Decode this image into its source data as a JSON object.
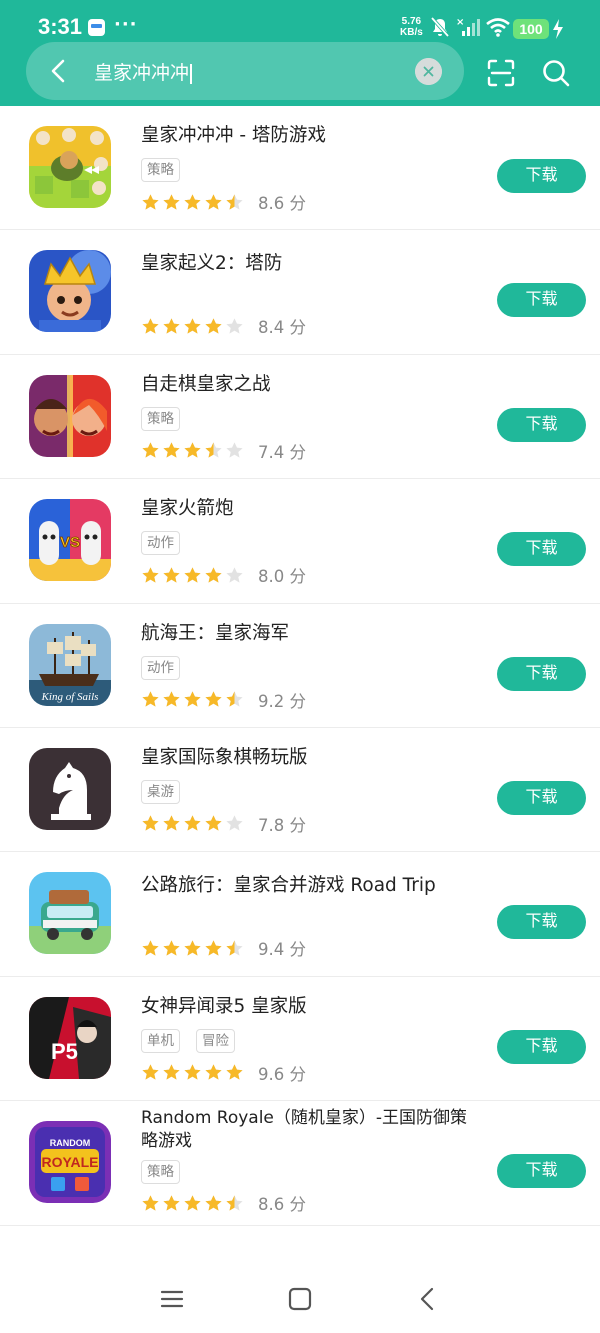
{
  "status_bar": {
    "time": "3:31",
    "net_speed_value": "5.76",
    "net_speed_unit": "KB/s",
    "battery": "100",
    "dots": "···"
  },
  "search": {
    "query": "皇家冲冲冲"
  },
  "apps": [
    {
      "name": "皇家冲冲冲 - 塔防游戏",
      "tags": [
        "策略"
      ],
      "rating": 4.5,
      "score": "8.6 分",
      "button": "下载",
      "icon": "tower-defense-icon"
    },
    {
      "name": "皇家起义2：塔防",
      "tags": [],
      "rating": 4,
      "score": "8.4 分",
      "button": "下载",
      "icon": "king-character-icon"
    },
    {
      "name": "自走棋皇家之战",
      "tags": [
        "策略"
      ],
      "rating": 3.5,
      "score": "7.4 分",
      "button": "下载",
      "icon": "two-heroes-icon"
    },
    {
      "name": "皇家火箭炮",
      "tags": [
        "动作"
      ],
      "rating": 4,
      "score": "8.0 分",
      "button": "下载",
      "icon": "vs-battle-icon"
    },
    {
      "name": "航海王：皇家海军",
      "tags": [
        "动作"
      ],
      "rating": 4.5,
      "score": "9.2 分",
      "button": "下载",
      "icon": "pirate-ship-icon"
    },
    {
      "name": "皇家国际象棋畅玩版",
      "tags": [
        "桌游"
      ],
      "rating": 4,
      "score": "7.8 分",
      "button": "下载",
      "icon": "chess-knight-icon"
    },
    {
      "name": "公路旅行：皇家合并游戏 Road Trip",
      "tags": [],
      "rating": 4.5,
      "score": "9.4 分",
      "button": "下载",
      "icon": "road-trip-van-icon"
    },
    {
      "name": "女神异闻录5 皇家版",
      "tags": [
        "单机",
        "冒险"
      ],
      "rating": 5,
      "score": "9.6 分",
      "button": "下载",
      "icon": "persona5-icon"
    },
    {
      "name": "Random Royale（随机皇家）-王国防御策略游戏",
      "tags": [
        "策略"
      ],
      "rating": 4.5,
      "score": "8.6 分",
      "button": "下载",
      "icon": "random-royale-icon"
    }
  ],
  "icon_texts": {
    "vs": "VS",
    "king_of_sails": "King of Sails",
    "persona": "P5",
    "random": "RANDOM",
    "royale": "ROYALE"
  },
  "colors": {
    "accent": "#20b89a",
    "star": "#f7b928",
    "star_empty": "#e2e2e2"
  }
}
